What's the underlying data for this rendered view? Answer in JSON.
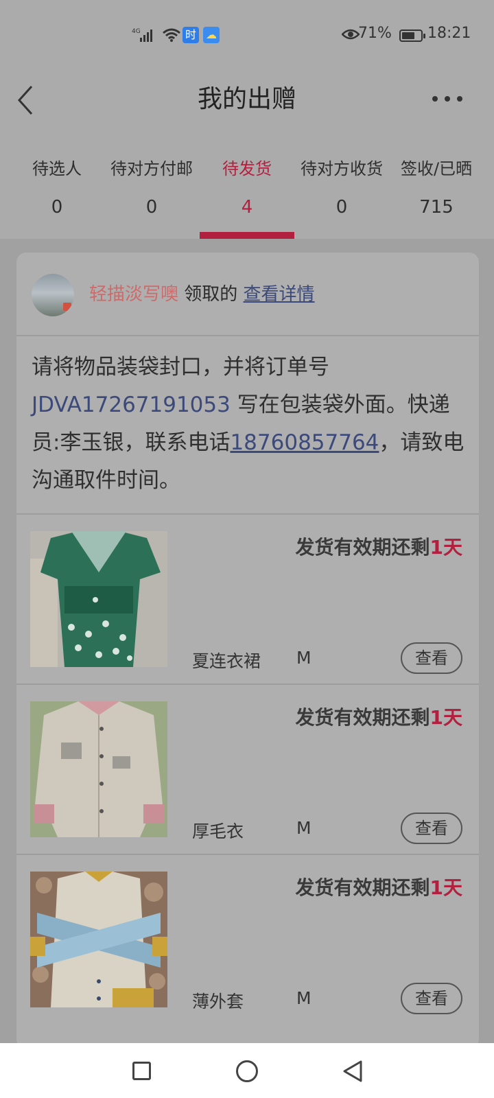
{
  "status_bar": {
    "network": "4G",
    "app_icon_1": "时",
    "app_icon_2": "weather-icon",
    "battery_percent": "71%",
    "battery_level": 0.71,
    "time": "18:21"
  },
  "header": {
    "title": "我的出赠",
    "back_icon": "chevron-left-icon",
    "more_icon": "more-dots-icon"
  },
  "tabs": [
    {
      "label": "待选人",
      "count": "0"
    },
    {
      "label": "待对方付邮",
      "count": "0"
    },
    {
      "label": "待发货",
      "count": "4",
      "active": true
    },
    {
      "label": "待对方收货",
      "count": "0"
    },
    {
      "label": "签收/已晒",
      "count": "715"
    }
  ],
  "card": {
    "giver_name": "轻描淡写噢",
    "giver_suffix": " 领取的 ",
    "detail_link": "查看详情",
    "notice_part1": "请将物品装袋封口，并将订单号 ",
    "order_no": "JDVA17267191053",
    "notice_part2": " 写在包装袋外面。快递员:李玉银，联系电话",
    "phone": "18760857764",
    "notice_part3": "，请致电沟通取件时间。"
  },
  "items": [
    {
      "deadline_prefix": "发货有效期还剩",
      "deadline_days": "1天",
      "name": "夏连衣裙",
      "size": "M",
      "button": "查看"
    },
    {
      "deadline_prefix": "发货有效期还剩",
      "deadline_days": "1天",
      "name": "厚毛衣",
      "size": "M",
      "button": "查看"
    },
    {
      "deadline_prefix": "发货有效期还剩",
      "deadline_days": "1天",
      "name": "薄外套",
      "size": "M",
      "button": "查看"
    }
  ],
  "colors": {
    "accent": "#b2203f",
    "link": "#3b4a7a",
    "giver_name": "#cf6a6a"
  }
}
